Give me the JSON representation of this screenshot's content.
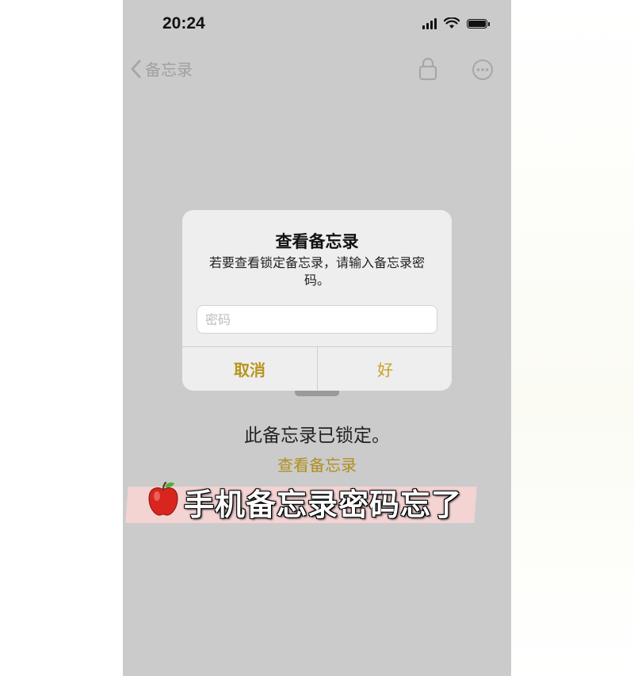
{
  "status_bar": {
    "time": "20:24",
    "icons": [
      "signal-icon",
      "wifi-icon",
      "battery-icon"
    ]
  },
  "nav": {
    "back_label": "备忘录",
    "icons": [
      "chevron-left-icon",
      "lock-icon",
      "more-icon"
    ]
  },
  "locked": {
    "message": "此备忘录已锁定。",
    "view_link": "查看备忘录"
  },
  "alert": {
    "title": "查看备忘录",
    "message": "若要查看锁定备忘录，请输入备忘录密码。",
    "password_placeholder": "密码",
    "cancel_label": "取消",
    "ok_label": "好"
  },
  "banner": {
    "text": "手机备忘录密码忘了",
    "icon": "apple-emoji"
  },
  "colors": {
    "accent": "#c9a227",
    "background": "#cbcbcb",
    "alert_background": "#eeeeee",
    "banner_highlight": "#f4d3d3"
  }
}
